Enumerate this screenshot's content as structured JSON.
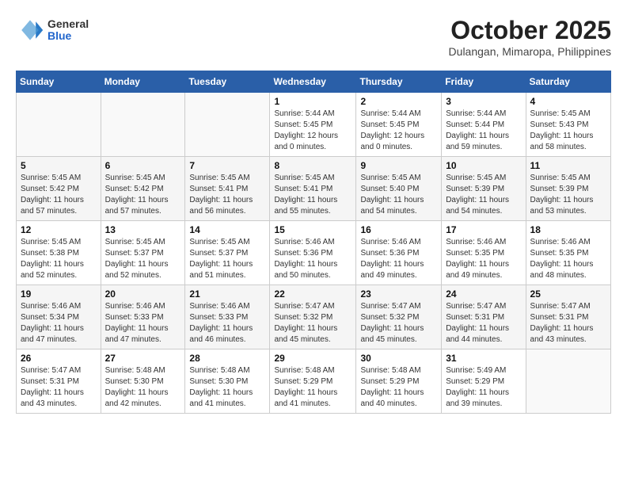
{
  "header": {
    "logo_general": "General",
    "logo_blue": "Blue",
    "month": "October 2025",
    "location": "Dulangan, Mimaropa, Philippines"
  },
  "days_of_week": [
    "Sunday",
    "Monday",
    "Tuesday",
    "Wednesday",
    "Thursday",
    "Friday",
    "Saturday"
  ],
  "weeks": [
    [
      {
        "day": "",
        "sunrise": "",
        "sunset": "",
        "daylight": ""
      },
      {
        "day": "",
        "sunrise": "",
        "sunset": "",
        "daylight": ""
      },
      {
        "day": "",
        "sunrise": "",
        "sunset": "",
        "daylight": ""
      },
      {
        "day": "1",
        "sunrise": "Sunrise: 5:44 AM",
        "sunset": "Sunset: 5:45 PM",
        "daylight": "Daylight: 12 hours and 0 minutes."
      },
      {
        "day": "2",
        "sunrise": "Sunrise: 5:44 AM",
        "sunset": "Sunset: 5:45 PM",
        "daylight": "Daylight: 12 hours and 0 minutes."
      },
      {
        "day": "3",
        "sunrise": "Sunrise: 5:44 AM",
        "sunset": "Sunset: 5:44 PM",
        "daylight": "Daylight: 11 hours and 59 minutes."
      },
      {
        "day": "4",
        "sunrise": "Sunrise: 5:45 AM",
        "sunset": "Sunset: 5:43 PM",
        "daylight": "Daylight: 11 hours and 58 minutes."
      }
    ],
    [
      {
        "day": "5",
        "sunrise": "Sunrise: 5:45 AM",
        "sunset": "Sunset: 5:42 PM",
        "daylight": "Daylight: 11 hours and 57 minutes."
      },
      {
        "day": "6",
        "sunrise": "Sunrise: 5:45 AM",
        "sunset": "Sunset: 5:42 PM",
        "daylight": "Daylight: 11 hours and 57 minutes."
      },
      {
        "day": "7",
        "sunrise": "Sunrise: 5:45 AM",
        "sunset": "Sunset: 5:41 PM",
        "daylight": "Daylight: 11 hours and 56 minutes."
      },
      {
        "day": "8",
        "sunrise": "Sunrise: 5:45 AM",
        "sunset": "Sunset: 5:41 PM",
        "daylight": "Daylight: 11 hours and 55 minutes."
      },
      {
        "day": "9",
        "sunrise": "Sunrise: 5:45 AM",
        "sunset": "Sunset: 5:40 PM",
        "daylight": "Daylight: 11 hours and 54 minutes."
      },
      {
        "day": "10",
        "sunrise": "Sunrise: 5:45 AM",
        "sunset": "Sunset: 5:39 PM",
        "daylight": "Daylight: 11 hours and 54 minutes."
      },
      {
        "day": "11",
        "sunrise": "Sunrise: 5:45 AM",
        "sunset": "Sunset: 5:39 PM",
        "daylight": "Daylight: 11 hours and 53 minutes."
      }
    ],
    [
      {
        "day": "12",
        "sunrise": "Sunrise: 5:45 AM",
        "sunset": "Sunset: 5:38 PM",
        "daylight": "Daylight: 11 hours and 52 minutes."
      },
      {
        "day": "13",
        "sunrise": "Sunrise: 5:45 AM",
        "sunset": "Sunset: 5:37 PM",
        "daylight": "Daylight: 11 hours and 52 minutes."
      },
      {
        "day": "14",
        "sunrise": "Sunrise: 5:45 AM",
        "sunset": "Sunset: 5:37 PM",
        "daylight": "Daylight: 11 hours and 51 minutes."
      },
      {
        "day": "15",
        "sunrise": "Sunrise: 5:46 AM",
        "sunset": "Sunset: 5:36 PM",
        "daylight": "Daylight: 11 hours and 50 minutes."
      },
      {
        "day": "16",
        "sunrise": "Sunrise: 5:46 AM",
        "sunset": "Sunset: 5:36 PM",
        "daylight": "Daylight: 11 hours and 49 minutes."
      },
      {
        "day": "17",
        "sunrise": "Sunrise: 5:46 AM",
        "sunset": "Sunset: 5:35 PM",
        "daylight": "Daylight: 11 hours and 49 minutes."
      },
      {
        "day": "18",
        "sunrise": "Sunrise: 5:46 AM",
        "sunset": "Sunset: 5:35 PM",
        "daylight": "Daylight: 11 hours and 48 minutes."
      }
    ],
    [
      {
        "day": "19",
        "sunrise": "Sunrise: 5:46 AM",
        "sunset": "Sunset: 5:34 PM",
        "daylight": "Daylight: 11 hours and 47 minutes."
      },
      {
        "day": "20",
        "sunrise": "Sunrise: 5:46 AM",
        "sunset": "Sunset: 5:33 PM",
        "daylight": "Daylight: 11 hours and 47 minutes."
      },
      {
        "day": "21",
        "sunrise": "Sunrise: 5:46 AM",
        "sunset": "Sunset: 5:33 PM",
        "daylight": "Daylight: 11 hours and 46 minutes."
      },
      {
        "day": "22",
        "sunrise": "Sunrise: 5:47 AM",
        "sunset": "Sunset: 5:32 PM",
        "daylight": "Daylight: 11 hours and 45 minutes."
      },
      {
        "day": "23",
        "sunrise": "Sunrise: 5:47 AM",
        "sunset": "Sunset: 5:32 PM",
        "daylight": "Daylight: 11 hours and 45 minutes."
      },
      {
        "day": "24",
        "sunrise": "Sunrise: 5:47 AM",
        "sunset": "Sunset: 5:31 PM",
        "daylight": "Daylight: 11 hours and 44 minutes."
      },
      {
        "day": "25",
        "sunrise": "Sunrise: 5:47 AM",
        "sunset": "Sunset: 5:31 PM",
        "daylight": "Daylight: 11 hours and 43 minutes."
      }
    ],
    [
      {
        "day": "26",
        "sunrise": "Sunrise: 5:47 AM",
        "sunset": "Sunset: 5:31 PM",
        "daylight": "Daylight: 11 hours and 43 minutes."
      },
      {
        "day": "27",
        "sunrise": "Sunrise: 5:48 AM",
        "sunset": "Sunset: 5:30 PM",
        "daylight": "Daylight: 11 hours and 42 minutes."
      },
      {
        "day": "28",
        "sunrise": "Sunrise: 5:48 AM",
        "sunset": "Sunset: 5:30 PM",
        "daylight": "Daylight: 11 hours and 41 minutes."
      },
      {
        "day": "29",
        "sunrise": "Sunrise: 5:48 AM",
        "sunset": "Sunset: 5:29 PM",
        "daylight": "Daylight: 11 hours and 41 minutes."
      },
      {
        "day": "30",
        "sunrise": "Sunrise: 5:48 AM",
        "sunset": "Sunset: 5:29 PM",
        "daylight": "Daylight: 11 hours and 40 minutes."
      },
      {
        "day": "31",
        "sunrise": "Sunrise: 5:49 AM",
        "sunset": "Sunset: 5:29 PM",
        "daylight": "Daylight: 11 hours and 39 minutes."
      },
      {
        "day": "",
        "sunrise": "",
        "sunset": "",
        "daylight": ""
      }
    ]
  ]
}
